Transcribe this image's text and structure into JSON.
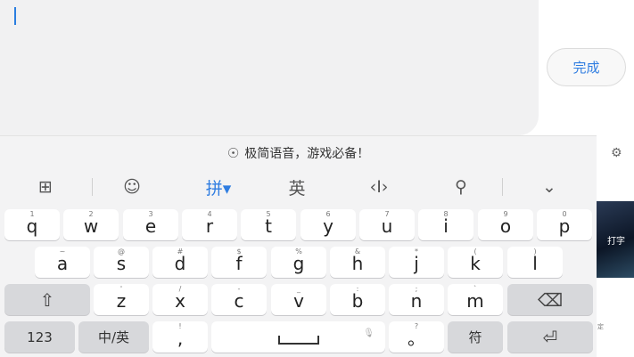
{
  "input": {
    "value": ""
  },
  "done_button": {
    "label": "完成"
  },
  "banner": {
    "text": "极简语音，游戏必备！"
  },
  "side_content": {
    "label": "打字",
    "sub": "定"
  },
  "toolbar": {
    "items": [
      {
        "name": "grid-icon",
        "glyph": "⊞"
      },
      {
        "name": "emoji-icon",
        "glyph": "☺"
      },
      {
        "name": "pinyin-mode",
        "glyph": "拼▾"
      },
      {
        "name": "english-mode",
        "glyph": "英"
      },
      {
        "name": "cursor-icon",
        "glyph": "‹I›"
      },
      {
        "name": "search-icon",
        "glyph": "⚲"
      },
      {
        "name": "collapse-icon",
        "glyph": "⌄"
      }
    ]
  },
  "rows": {
    "r1": [
      {
        "k": "q",
        "s": "1"
      },
      {
        "k": "w",
        "s": "2"
      },
      {
        "k": "e",
        "s": "3"
      },
      {
        "k": "r",
        "s": "4"
      },
      {
        "k": "t",
        "s": "5"
      },
      {
        "k": "y",
        "s": "6"
      },
      {
        "k": "u",
        "s": "7"
      },
      {
        "k": "i",
        "s": "8"
      },
      {
        "k": "o",
        "s": "9"
      },
      {
        "k": "p",
        "s": "0"
      }
    ],
    "r2": [
      {
        "k": "a",
        "s": "~"
      },
      {
        "k": "s",
        "s": "@"
      },
      {
        "k": "d",
        "s": "#"
      },
      {
        "k": "f",
        "s": "$"
      },
      {
        "k": "g",
        "s": "%"
      },
      {
        "k": "h",
        "s": "&"
      },
      {
        "k": "j",
        "s": "*"
      },
      {
        "k": "k",
        "s": "("
      },
      {
        "k": "l",
        "s": ")"
      }
    ],
    "r3": [
      {
        "k": "z",
        "s": "'"
      },
      {
        "k": "x",
        "s": "/"
      },
      {
        "k": "c",
        "s": "-"
      },
      {
        "k": "v",
        "s": "_"
      },
      {
        "k": "b",
        "s": ":"
      },
      {
        "k": "n",
        "s": ";"
      },
      {
        "k": "m",
        "s": "`"
      }
    ]
  },
  "bottom": {
    "num_label": "123",
    "lang_label": "中/英",
    "comma_main": ",",
    "comma_sub": "!",
    "period_main": "。",
    "period_sub": "?",
    "symbol_label": "符"
  },
  "icons": {
    "shift": "⇧",
    "backspace": "⌫",
    "enter": "⏎",
    "mic": "🎙",
    "gear": "⚙",
    "voice": "☉"
  },
  "colors": {
    "accent": "#2f7de1",
    "key": "#ffffff",
    "fn_key": "#d7d8db"
  }
}
